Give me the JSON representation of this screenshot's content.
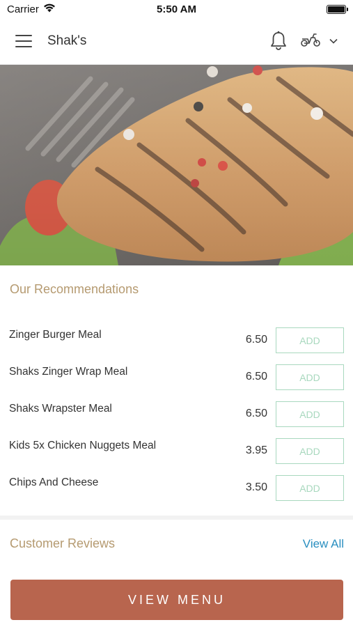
{
  "status_bar": {
    "carrier": "Carrier",
    "time": "5:50 AM"
  },
  "header": {
    "title": "Shak's",
    "icons": [
      "menu-icon",
      "bell-icon",
      "scooter-icon",
      "chevron-down-icon"
    ]
  },
  "hero": {
    "icon": "grilled-chicken-photo"
  },
  "recommendations": {
    "title": "Our Recommendations",
    "items": [
      {
        "name": "Zinger Burger Meal",
        "price": "6.50",
        "button": "ADD"
      },
      {
        "name": "Shaks Zinger Wrap Meal",
        "price": "6.50",
        "button": "ADD"
      },
      {
        "name": "Shaks Wrapster Meal",
        "price": "6.50",
        "button": "ADD"
      },
      {
        "name": "Kids 5x Chicken Nuggets Meal",
        "price": "3.95",
        "button": "ADD"
      },
      {
        "name": "Chips And Cheese",
        "price": "3.50",
        "button": "ADD"
      }
    ]
  },
  "reviews": {
    "title": "Customer Reviews",
    "view_all": "View All"
  },
  "footer": {
    "view_menu": "VIEW MENU"
  },
  "colors": {
    "accent_gold": "#b59a70",
    "add_border": "#a8d8be",
    "link_blue": "#2a8fc0",
    "button_brown": "#b8654e"
  }
}
